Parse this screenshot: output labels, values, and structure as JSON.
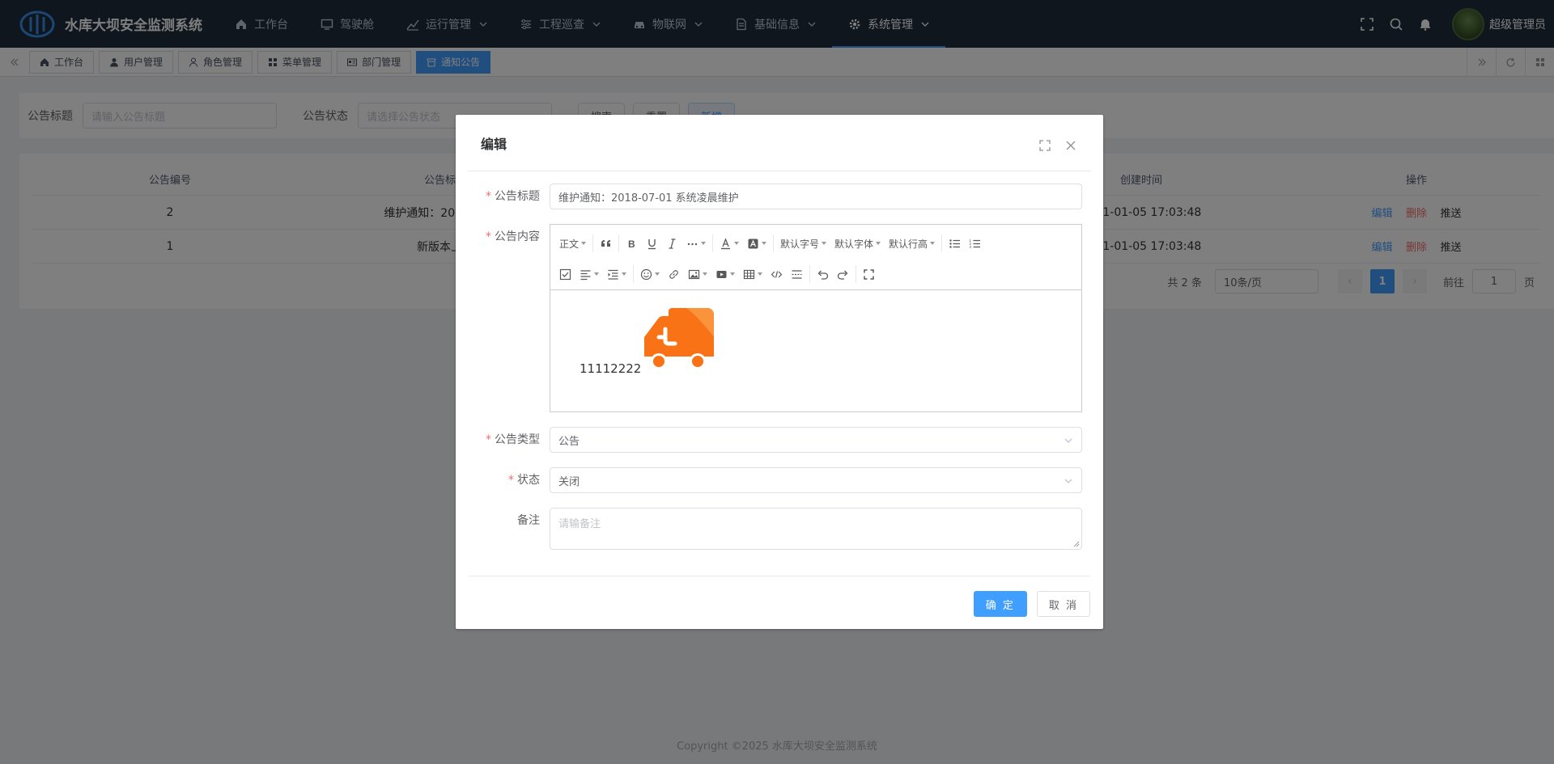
{
  "app": {
    "title": "水库大坝安全监测系统",
    "user": "超级管理员",
    "accent": "#409eff",
    "nav_bg": "#1f2d3d"
  },
  "nav": {
    "items": [
      {
        "label": "工作台",
        "icon": "home-icon"
      },
      {
        "label": "驾驶舱",
        "icon": "monitor-icon"
      },
      {
        "label": "运行管理",
        "icon": "chart-icon",
        "dropdown": true
      },
      {
        "label": "工程巡查",
        "icon": "sliders-icon",
        "dropdown": true
      },
      {
        "label": "物联网",
        "icon": "car-icon",
        "dropdown": true
      },
      {
        "label": "基础信息",
        "icon": "document-icon",
        "dropdown": true
      },
      {
        "label": "系统管理",
        "icon": "gear-icon",
        "dropdown": true,
        "active": true
      }
    ]
  },
  "tags": [
    {
      "label": "工作台",
      "icon": "home-icon"
    },
    {
      "label": "用户管理",
      "icon": "user-icon"
    },
    {
      "label": "角色管理",
      "icon": "person-icon"
    },
    {
      "label": "菜单管理",
      "icon": "grid-icon"
    },
    {
      "label": "部门管理",
      "icon": "idcard-icon"
    },
    {
      "label": "通知公告",
      "icon": "bell-box-icon",
      "active": true
    }
  ],
  "search": {
    "title_label": "公告标题",
    "title_placeholder": "请输入公告标题",
    "status_label": "公告状态",
    "status_placeholder": "请选择公告状态",
    "search_btn": "搜索",
    "reset_btn": "重置",
    "add_btn": "新增"
  },
  "table": {
    "columns": [
      "公告编号",
      "公告标题",
      "创建时间",
      "操作"
    ],
    "rows": [
      {
        "id": "2",
        "title": "维护通知：2018-07-01",
        "created": "2021-01-05 17:03:48"
      },
      {
        "id": "1",
        "title": "新版本上线",
        "created": "2021-01-05 17:03:48"
      }
    ],
    "ops": {
      "edit": "编辑",
      "delete": "删除",
      "push": "推送"
    }
  },
  "pager": {
    "total": "共 2 条",
    "size": "10条/页",
    "current": "1",
    "goto_label": "前往",
    "goto_value": "1",
    "page_unit": "页"
  },
  "footer": "Copyright ©2025 水库大坝安全监测系统",
  "dialog": {
    "title": "编辑",
    "title_label": "公告标题",
    "title_value": "维护通知：2018-07-01 系统凌晨维护",
    "content_label": "公告内容",
    "editor": {
      "style_btn": "正文",
      "font_size_btn": "默认字号",
      "font_family_btn": "默认字体",
      "line_height_btn": "默认行高",
      "body_text": "11112222"
    },
    "type_label": "公告类型",
    "type_value": "公告",
    "status_label": "状态",
    "status_value": "关闭",
    "remark_label": "备注",
    "remark_placeholder": "请输备注",
    "confirm_btn": "确 定",
    "cancel_btn": "取 消"
  }
}
